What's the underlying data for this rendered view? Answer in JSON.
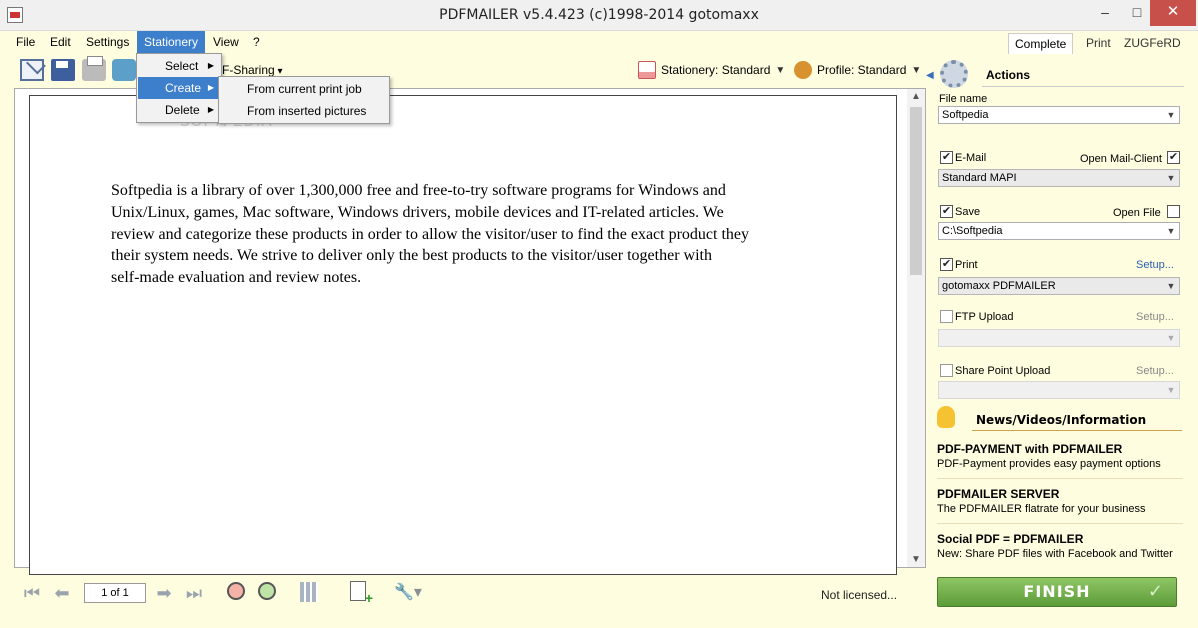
{
  "window": {
    "title": "PDFMAILER v5.4.423 (c)1998-2014 gotomaxx",
    "min": "–",
    "max": "□",
    "close": "✕"
  },
  "menubar": {
    "file": "File",
    "edit": "Edit",
    "settings": "Settings",
    "stationery": "Stationery",
    "view": "View",
    "help": "?"
  },
  "mode_tabs": {
    "complete": "Complete",
    "print": "Print",
    "zugferd": "ZUGFeRD"
  },
  "toolbar": {
    "fsharing": "F-Sharing",
    "stationery": "Stationery: Standard",
    "profile": "Profile: Standard"
  },
  "stationery_menu": {
    "select": "Select",
    "create": "Create",
    "delete": "Delete",
    "submenu_arrow": "▶",
    "create_submenu": [
      "From current print job",
      "From inserted pictures"
    ]
  },
  "document": {
    "watermark": "SOFTPEDIA",
    "lines": [
      "Softpedia is a library of over 1,300,000 free and free-to-try software programs for Windows and",
      "Unix/Linux, games, Mac software, Windows drivers, mobile devices and IT-related articles. We",
      "review and categorize these products in order to allow the visitor/user to find the exact product they",
      "their system needs. We strive to deliver only the best products to the visitor/user together with",
      "self-made evaluation and review notes."
    ]
  },
  "navbar": {
    "page_indicator": "1 of 1",
    "license_status": "Not licensed..."
  },
  "actions": {
    "title": "Actions",
    "file_name_label": "File name",
    "file_name": "Softpedia",
    "email": {
      "label": "E-Mail",
      "checked": true,
      "open_client_label": "Open Mail-Client",
      "open_client_checked": true,
      "method": "Standard MAPI"
    },
    "save": {
      "label": "Save",
      "checked": true,
      "open_file_label": "Open File",
      "open_file_checked": false,
      "path": "C:\\Softpedia"
    },
    "print": {
      "label": "Print",
      "checked": true,
      "setup_label": "Setup...",
      "printer": "gotomaxx PDFMAILER"
    },
    "ftp": {
      "label": "FTP Upload",
      "checked": false,
      "setup_label": "Setup..."
    },
    "sharepoint": {
      "label": "Share Point Upload",
      "checked": false,
      "setup_label": "Setup..."
    }
  },
  "news": {
    "title": "News/Videos/Information",
    "items": [
      {
        "headline": "PDF-PAYMENT with PDFMAILER",
        "summary": "PDF-Payment provides easy payment options"
      },
      {
        "headline": "PDFMAILER SERVER",
        "summary": "The PDFMAILER flatrate for your business"
      },
      {
        "headline": "Social PDF = PDFMAILER",
        "summary": "New: Share PDF files with Facebook and Twitter"
      }
    ]
  },
  "finish_label": "FINISH",
  "colors": {
    "accent": "#3d7fcb",
    "panel_bg": "#fffde0",
    "finish_green": "#5d9c3a",
    "highlight": "#b3b3f5"
  }
}
